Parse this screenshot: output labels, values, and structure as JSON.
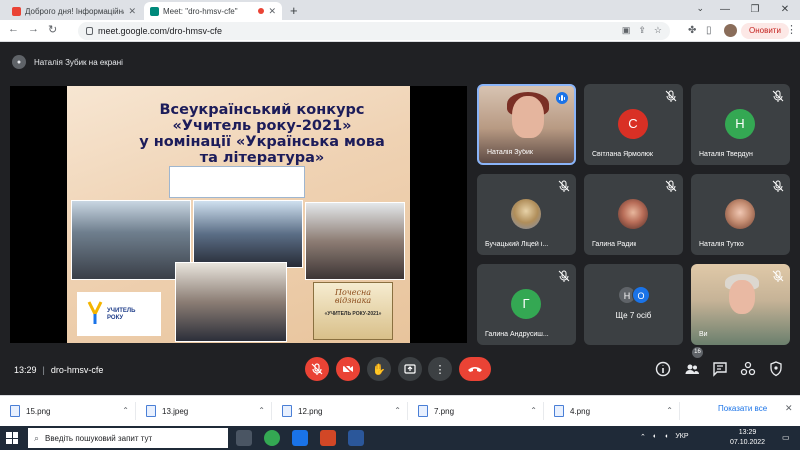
{
  "browser": {
    "tabs": [
      {
        "title": "Доброго дня! Інформаційна пл..."
      },
      {
        "title": "Meet: \"dro-hmsv-cfe\""
      }
    ],
    "url": "meet.google.com/dro-hmsv-cfe",
    "update_label": "Оновити"
  },
  "meet": {
    "presenter_label": "Наталія Зубик на екрані",
    "slide": {
      "title_lines": [
        "Всеукраїнський конкурс",
        "«Учитель року-2021»",
        "у номінації «Українська мова",
        "та література»"
      ],
      "logo_text_1": "УЧИТЕЛЬ",
      "logo_text_2": "РОКУ",
      "cert_title_1": "Почесна",
      "cert_title_2": "відзнака",
      "cert_sub": "«УЧИТЕЛЬ РОКУ-2021»"
    },
    "participants": [
      {
        "name": "Наталія Зубик",
        "type": "video"
      },
      {
        "name": "Світлана Ярмолюк",
        "initial": "С",
        "color": "#d93025"
      },
      {
        "name": "Наталія Твердун",
        "initial": "Н",
        "color": "#34a853"
      },
      {
        "name": "Бучацький Ліцей і...",
        "type": "photo"
      },
      {
        "name": "Галина Радик",
        "type": "photo"
      },
      {
        "name": "Наталія Тутко",
        "type": "photo"
      },
      {
        "name": "Галина Андрусиш...",
        "initial": "Г",
        "color": "#34a853"
      },
      {
        "more_initials": [
          "Н",
          "О"
        ],
        "more_label": "Ще 7 осіб"
      },
      {
        "name": "Ви",
        "type": "self"
      }
    ],
    "meeting_time": "13:29",
    "meeting_code": "dro-hmsv-cfe",
    "participant_count": "16"
  },
  "downloads": {
    "items": [
      "15.png",
      "13.jpeg",
      "12.png",
      "7.png",
      "4.png"
    ],
    "show_all": "Показати все"
  },
  "taskbar": {
    "search_placeholder": "Введіть пошуковий запит тут",
    "lang": "УКР",
    "time": "13:29",
    "date": "07.10.2022"
  }
}
